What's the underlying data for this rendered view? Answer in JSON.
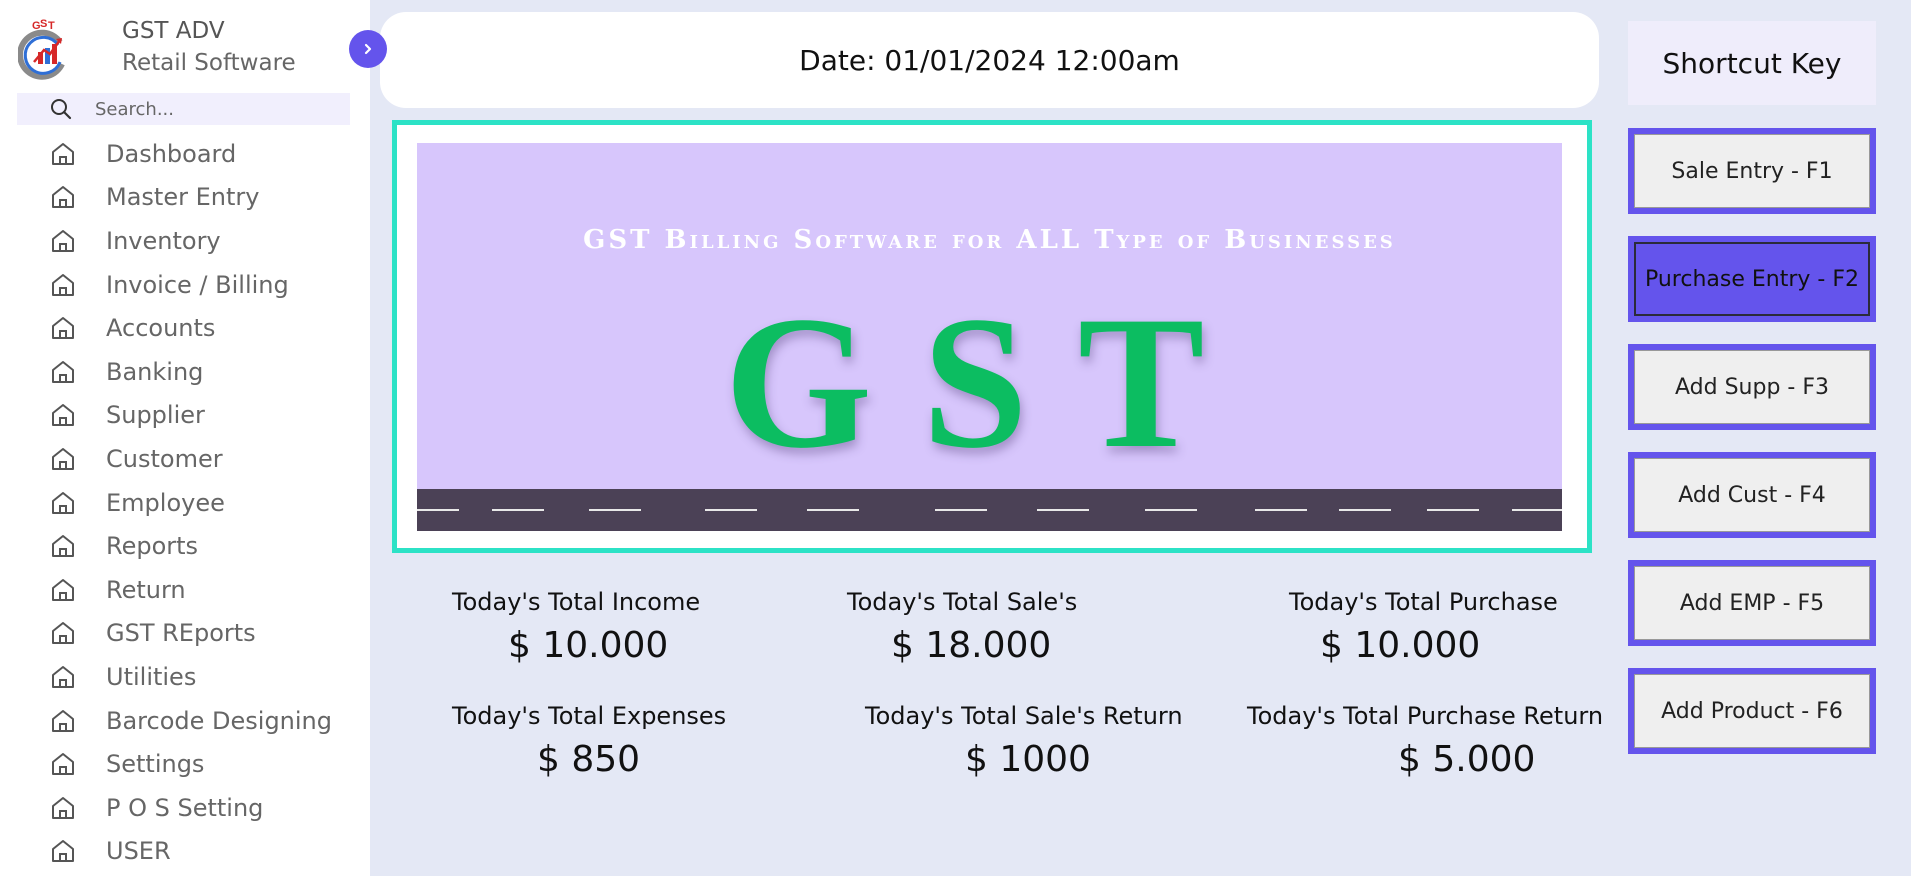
{
  "app": {
    "name": "GST ADV",
    "subtitle": "Retail Software"
  },
  "search": {
    "placeholder": "Search..."
  },
  "sidebar": {
    "items": [
      {
        "label": "Dashboard"
      },
      {
        "label": "Master Entry"
      },
      {
        "label": "Inventory"
      },
      {
        "label": "Invoice / Billing"
      },
      {
        "label": "Accounts"
      },
      {
        "label": "Banking"
      },
      {
        "label": "Supplier"
      },
      {
        "label": "Customer"
      },
      {
        "label": "Employee"
      },
      {
        "label": "Reports"
      },
      {
        "label": "Return"
      },
      {
        "label": "GST REports"
      },
      {
        "label": "Utilities"
      },
      {
        "label": "Barcode Designing"
      },
      {
        "label": "Settings"
      },
      {
        "label": "P O S Setting"
      },
      {
        "label": "USER"
      }
    ]
  },
  "header": {
    "date": "Date: 01/01/2024 12:00am"
  },
  "banner": {
    "tagline": "GST Billing Software for ALL Type of Businesses",
    "logo_text": "GST"
  },
  "stats": {
    "income": {
      "label": "Today's Total Income",
      "value": "$ 10.000"
    },
    "sale": {
      "label": "Today's Total Sale's",
      "value": "$ 18.000"
    },
    "purchase": {
      "label": "Today's Total Purchase",
      "value": "$ 10.000"
    },
    "expenses": {
      "label": "Today's Total Expenses",
      "value": "$ 850"
    },
    "sale_return": {
      "label": "Today's Total Sale's Return",
      "value": "$ 1000"
    },
    "purchase_return": {
      "label": "Today's Total Purchase Return",
      "value": "$ 5.000"
    }
  },
  "shortcuts": {
    "title": "Shortcut Key",
    "items": [
      {
        "label": "Sale Entry - F1"
      },
      {
        "label": "Purchase Entry - F2"
      },
      {
        "label": "Add Supp - F3"
      },
      {
        "label": "Add Cust - F4"
      },
      {
        "label": "Add EMP - F5"
      },
      {
        "label": "Add Product - F6"
      }
    ]
  },
  "icons": {
    "nav": "home-icon",
    "search": "search-icon",
    "toggle": "chevron-right-icon",
    "logo": "gst-logo-icon"
  },
  "colors": {
    "accent": "#6454ec",
    "banner_border": "#2ce2c6",
    "banner_bg": "#d7c6fc",
    "logo_green": "#0cbd61",
    "page_bg": "#e4e8f5"
  }
}
